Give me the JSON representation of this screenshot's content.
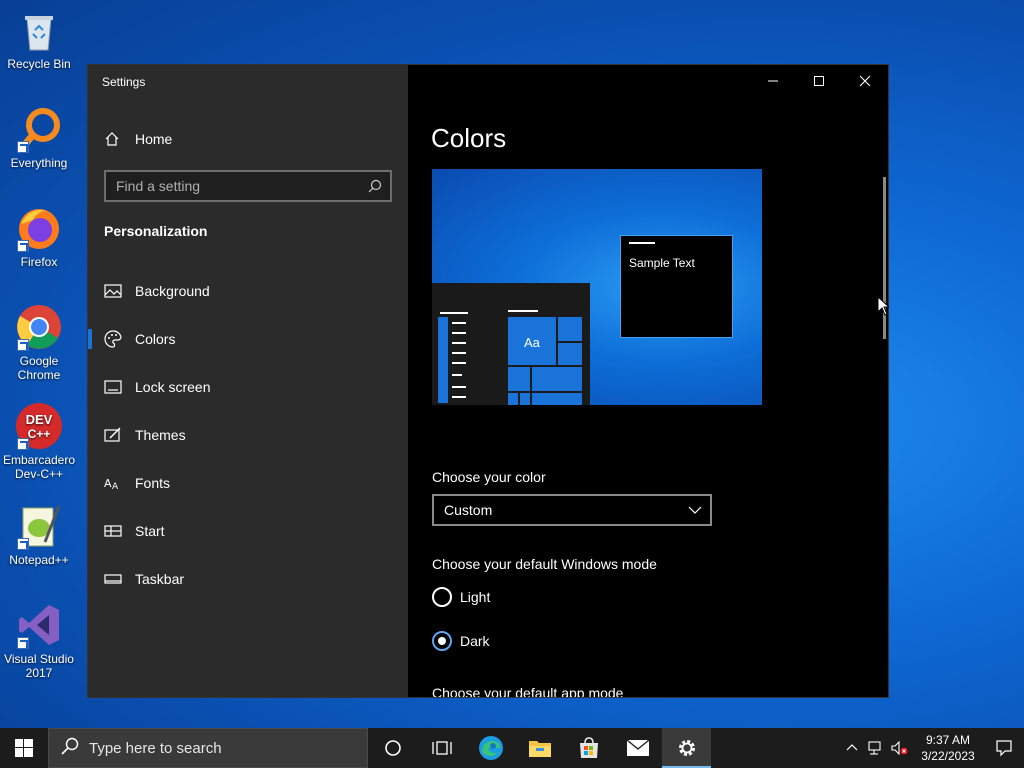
{
  "desktop": {
    "icons": [
      {
        "label": "Recycle Bin",
        "icon": "recycle-bin-icon"
      },
      {
        "label": "Everything",
        "icon": "everything-search-icon"
      },
      {
        "label": "Firefox",
        "icon": "firefox-icon"
      },
      {
        "label": "Google Chrome",
        "icon": "chrome-icon"
      },
      {
        "label": "Embarcadero Dev-C++",
        "icon": "devcpp-icon"
      },
      {
        "label": "Notepad++",
        "icon": "notepadpp-icon"
      },
      {
        "label": "Visual Studio 2017",
        "icon": "visual-studio-icon"
      }
    ]
  },
  "window": {
    "title": "Settings",
    "caption_buttons": [
      "minimize",
      "maximize",
      "close"
    ]
  },
  "sidebar": {
    "home_label": "Home",
    "search_placeholder": "Find a setting",
    "section_title": "Personalization",
    "items": [
      {
        "label": "Background",
        "icon": "background-icon",
        "active": false
      },
      {
        "label": "Colors",
        "icon": "palette-icon",
        "active": true
      },
      {
        "label": "Lock screen",
        "icon": "lock-screen-icon",
        "active": false
      },
      {
        "label": "Themes",
        "icon": "themes-icon",
        "active": false
      },
      {
        "label": "Fonts",
        "icon": "fonts-icon",
        "active": false
      },
      {
        "label": "Start",
        "icon": "start-icon",
        "active": false
      },
      {
        "label": "Taskbar",
        "icon": "taskbar-icon",
        "active": false
      }
    ]
  },
  "main": {
    "page_title": "Colors",
    "preview": {
      "sample_text": "Sample Text",
      "tile_text": "Aa"
    },
    "choose_color_label": "Choose your color",
    "choose_color_value": "Custom",
    "windows_mode_label": "Choose your default Windows mode",
    "windows_mode_options": [
      {
        "label": "Light",
        "checked": false
      },
      {
        "label": "Dark",
        "checked": true
      }
    ],
    "app_mode_label": "Choose your default app mode"
  },
  "taskbar": {
    "search_placeholder": "Type here to search",
    "apps": [
      "cortana-icon",
      "task-view-icon",
      "edge-icon",
      "file-explorer-icon",
      "store-icon",
      "mail-icon",
      "settings-icon"
    ],
    "active_app": "settings-icon",
    "clock_time": "9:37 AM",
    "clock_date": "3/22/2023"
  },
  "colors": {
    "accent": "#1a73d9",
    "sidebar_bg": "#2b2b2b",
    "main_bg": "#000000",
    "taskbar_bg": "#1c1c1c"
  }
}
